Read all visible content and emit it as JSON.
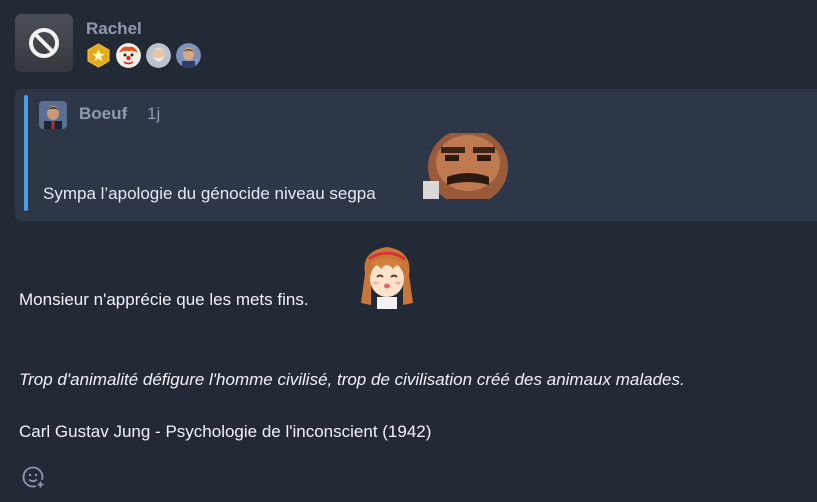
{
  "author": {
    "name": "Rachel",
    "avatar_icon": "no-entry-icon",
    "badges": [
      "gold-star-badge",
      "clown-badge",
      "bearded-man-badge",
      "man-portrait-badge"
    ]
  },
  "quote": {
    "author": "Boeuf",
    "separator": "·",
    "time": "1j",
    "text": "Sympa l’apologie du génocide niveau segpa",
    "accent_color": "#4a9fe6"
  },
  "body": {
    "line1": "Monsieur n'apprécie que les mets fins.",
    "quote_italic": "Trop d'animalité défigure l'homme civilisé, trop de civilisation créé des animaux malades.",
    "citation": "Carl Gustav Jung - Psychologie de l'inconscient (1942)"
  },
  "actions": {
    "react_icon": "add-reaction-icon"
  }
}
